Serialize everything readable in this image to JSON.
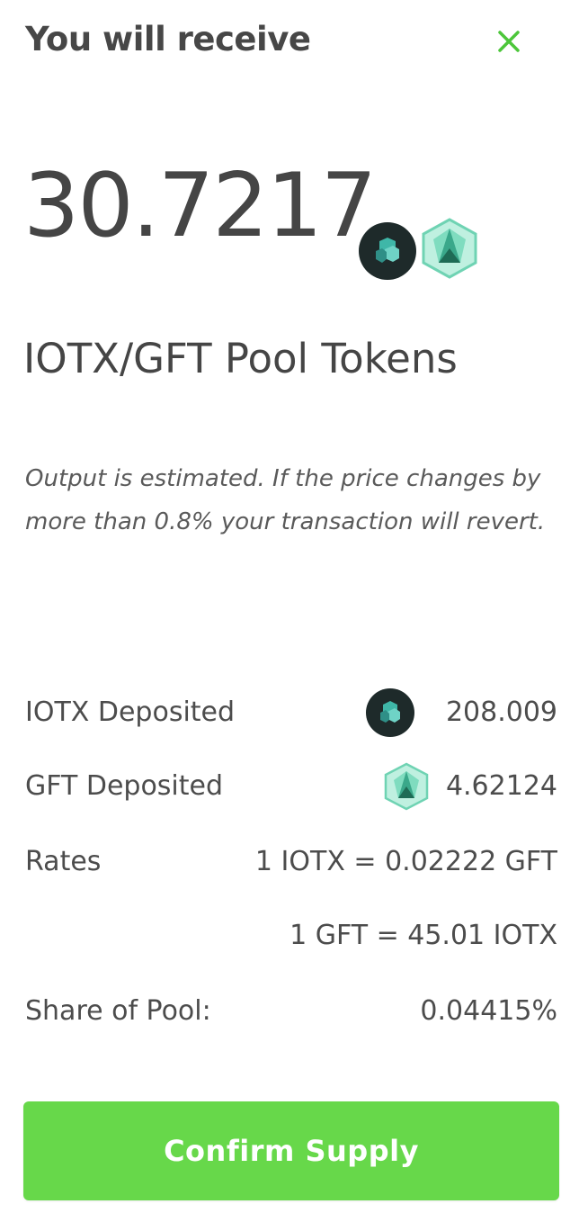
{
  "header": {
    "title": "You will receive"
  },
  "summary": {
    "amount": "30.7217",
    "pool_label": "IOTX/GFT Pool Tokens"
  },
  "note": "Output is estimated. If the price changes by more than 0.8% your transaction will revert.",
  "details": {
    "iotx_deposited_label": "IOTX Deposited",
    "iotx_deposited_value": "208.009",
    "gft_deposited_label": "GFT Deposited",
    "gft_deposited_value": "4.62124",
    "rates_label": "Rates",
    "rate_1": "1 IOTX = 0.02222 GFT",
    "rate_2": "1 GFT = 45.01 IOTX",
    "share_label": "Share of Pool:",
    "share_value": "0.04415%"
  },
  "confirm_label": "Confirm Supply",
  "colors": {
    "accent": "#67d84a",
    "close": "#4cc63a",
    "iotx": "#1e2a2a",
    "gft": "#6fd3b3"
  },
  "icons": [
    "close-icon",
    "iotx-token-icon",
    "gft-token-icon"
  ]
}
